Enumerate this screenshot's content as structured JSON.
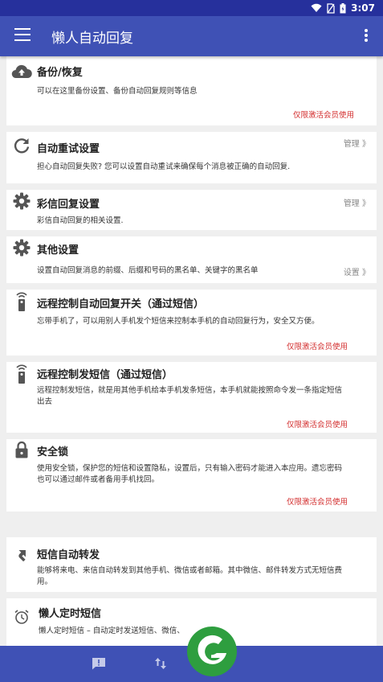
{
  "status": {
    "time": "3:07"
  },
  "appbar": {
    "title": "懒人自动回复"
  },
  "cards": [
    {
      "title": "备份/恢复",
      "desc": "可以在这里备份设置、备份自动回复规则等信息",
      "vip": "仅限激活会员使用"
    },
    {
      "title": "自动重试设置",
      "manage": "管理 》",
      "desc": "担心自动回复失败? 您可以设置自动重试来确保每个消息被正确的自动回复."
    },
    {
      "title": "彩信回复设置",
      "manage": "管理 》",
      "desc": "彩信自动回复的相关设置."
    },
    {
      "title": "其他设置",
      "manage": "设置 》",
      "desc": "设置自动回复消息的前缀、后缀和号码的黑名单、关键字的黑名单"
    },
    {
      "title": "远程控制自动回复开关（通过短信）",
      "desc": "忘带手机了，可以用别人手机发个短信来控制本手机的自动回复行为，安全又方便。",
      "vip": "仅限激活会员使用"
    },
    {
      "title": "远程控制发短信（通过短信）",
      "desc": "远程控制发短信，就是用其他手机给本手机发条短信，本手机就能按照命令发一条指定短信出去",
      "vip": "仅限激活会员使用"
    },
    {
      "title": "安全锁",
      "desc": "使用安全锁，保护您的短信和设置隐私，设置后，只有输入密码才能进入本应用。遗忘密码也可以通过邮件或者备用手机找回。",
      "vip": "仅限激活会员使用"
    },
    {
      "title": "短信自动转发",
      "desc": "能够将来电、来信自动转发到其他手机、微信或者邮箱。其中微信、邮件转发方式无短信费用。"
    },
    {
      "title": "懒人定时短信",
      "desc": "懒人定时短信 – 自动定时发送短信、微信、"
    }
  ],
  "colors": {
    "primary": "#3f51b5",
    "statusbar": "#26309c",
    "vip": "#d32f2f",
    "logo": "#2e9e3f"
  },
  "icons": [
    "cloud-upload-icon",
    "refresh-icon",
    "gear-icon",
    "gear-icon",
    "remote-icon",
    "remote-icon",
    "lock-icon",
    "forward-icon",
    "alarm-icon",
    "feedback-icon",
    "transfer-icon"
  ]
}
